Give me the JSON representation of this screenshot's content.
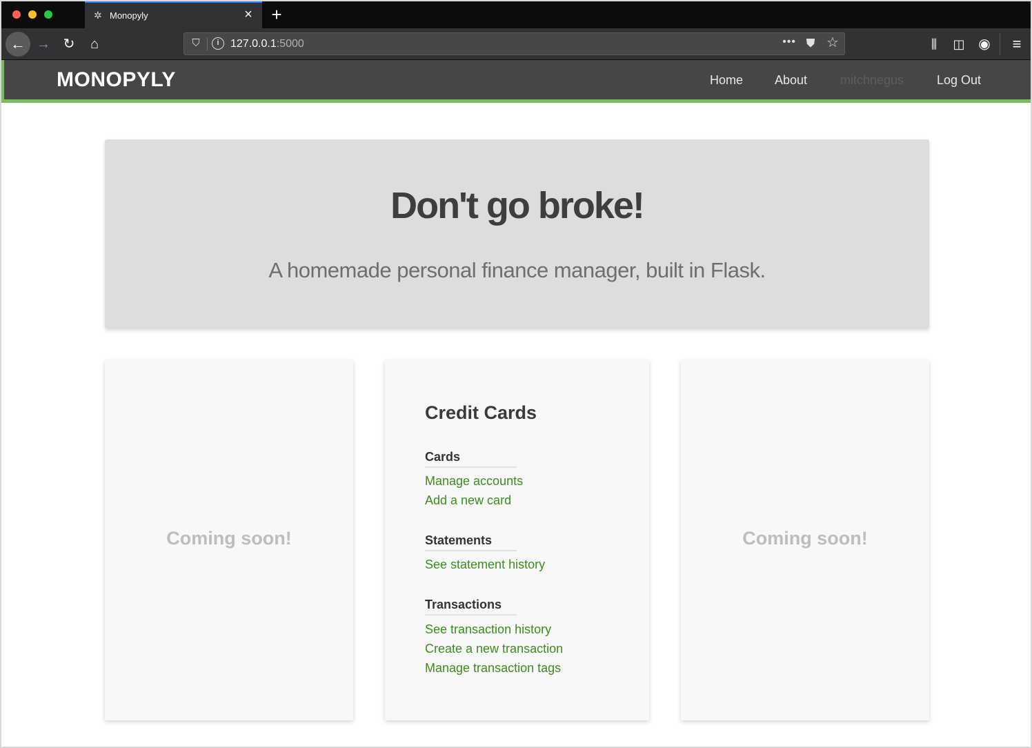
{
  "browser": {
    "tab": {
      "title": "Monopyly",
      "favicon": "monopyly-favicon-icon"
    },
    "url": {
      "host": "127.0.0.1",
      "port": ":5000"
    },
    "icons": [
      "back-icon",
      "forward-icon",
      "reload-icon",
      "home-icon",
      "shield-icon",
      "info-icon",
      "more-icon",
      "pocket-icon",
      "star-icon",
      "library-icon",
      "sidebar-icon",
      "account-icon",
      "menu-icon"
    ]
  },
  "site": {
    "brand": "MONOPYLY",
    "nav": {
      "home": "Home",
      "about": "About",
      "user": "mitchnegus",
      "logout": "Log Out"
    },
    "accent_color": "#7cbb5b"
  },
  "hero": {
    "title": "Don't go broke!",
    "subtitle": "A homemade personal finance manager, built in Flask."
  },
  "panels": {
    "left": {
      "text": "Coming soon!"
    },
    "right": {
      "text": "Coming soon!"
    },
    "credit_cards": {
      "title": "Credit Cards",
      "sections": [
        {
          "heading": "Cards",
          "links": [
            "Manage accounts",
            "Add a new card"
          ]
        },
        {
          "heading": "Statements",
          "links": [
            "See statement history"
          ]
        },
        {
          "heading": "Transactions",
          "links": [
            "See transaction history",
            "Create a new transaction",
            "Manage transaction tags"
          ]
        }
      ],
      "link_color": "#3d8b1f"
    }
  }
}
